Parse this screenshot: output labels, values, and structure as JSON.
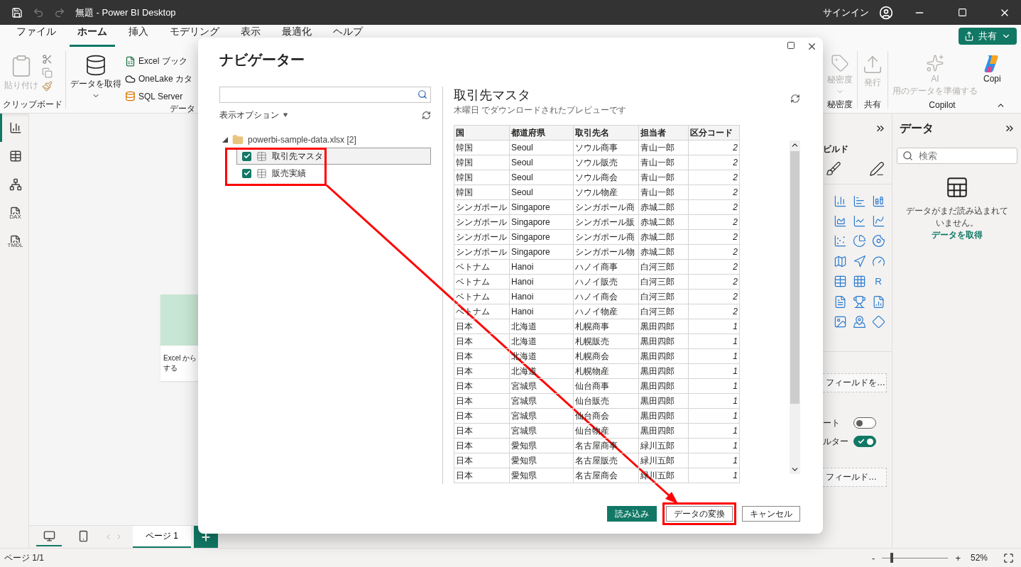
{
  "window": {
    "title": "無題 - Power BI Desktop",
    "sign_in": "サインイン",
    "undo_disabled": true
  },
  "menu_tabs": [
    {
      "label": "ファイル",
      "selected": false
    },
    {
      "label": "ホーム",
      "selected": true
    },
    {
      "label": "挿入",
      "selected": false
    },
    {
      "label": "モデリング",
      "selected": false
    },
    {
      "label": "表示",
      "selected": false
    },
    {
      "label": "最適化",
      "selected": false
    },
    {
      "label": "ヘルプ",
      "selected": false
    }
  ],
  "share_button": {
    "label": "共有"
  },
  "ribbon": {
    "clipboard": {
      "paste": {
        "label": "貼り付け",
        "disabled": true
      },
      "group_label": "クリップボード"
    },
    "data": {
      "get_data": "データを取得",
      "sources": [
        {
          "kind": "excel",
          "label": "Excel ブック"
        },
        {
          "kind": "onelake",
          "label": "OneLake カタ"
        },
        {
          "kind": "sql",
          "label": "SQL Server"
        }
      ],
      "group_label": "データ"
    },
    "sensitivity": {
      "button": {
        "label": "秘密度",
        "disabled": true
      },
      "group_label": "秘密度"
    },
    "share": {
      "button": {
        "label": "発行",
        "disabled": true
      },
      "group_label": "共有"
    },
    "copilot": {
      "ai_button": {
        "lines": [
          "AI",
          "用のデータを準備する"
        ],
        "disabled": true
      },
      "copilot_button": {
        "label": "Copi",
        "disabled": false
      },
      "group_label": "Copilot"
    }
  },
  "rail": [
    {
      "kind": "report",
      "selected": true
    },
    {
      "kind": "table",
      "selected": false
    },
    {
      "kind": "model",
      "selected": false
    },
    {
      "kind": "dax",
      "label": "DAX",
      "selected": false
    },
    {
      "kind": "tmdl",
      "label": "TMDL",
      "selected": false
    }
  ],
  "canvas_card": {
    "lines": [
      "Excel から",
      "する"
    ]
  },
  "page_bar": {
    "views": [
      {
        "kind": "desktop",
        "selected": true
      },
      {
        "kind": "mobile",
        "selected": false
      }
    ],
    "pages": [
      {
        "label": "ページ 1",
        "selected": true
      }
    ]
  },
  "visualizations": {
    "section_label": "ビルド",
    "r_visual": "R",
    "well_1": "フィールドを…",
    "toggles": [
      {
        "label": "ート",
        "on": false
      },
      {
        "label": "ルター",
        "on": true
      }
    ],
    "well_2": "フィールド…"
  },
  "data_pane": {
    "title": "データ",
    "search_placeholder": "検索",
    "message": "データがまだ読み込まれていません。",
    "link": "データを取得"
  },
  "status_bar": {
    "page": "ページ 1/1",
    "zoom_out": "-",
    "zoom_in": "+",
    "zoom": {
      "level": 0.14
    },
    "zoom_reading": "52%"
  },
  "dialog": {
    "title": "ナビゲーター",
    "display_options": "表示オプション",
    "arrow": true,
    "tree": {
      "label": "powerbi-sample-data.xlsx [2]",
      "expanded": true,
      "highlight_frame": true,
      "children": [
        {
          "label": "取引先マスタ",
          "checked": true,
          "selected": true
        },
        {
          "label": "販売実績",
          "checked": true,
          "selected": false
        }
      ]
    },
    "preview": {
      "title": "取引先マスタ",
      "subtitle": "木曜日 でダウンロードされたプレビューです",
      "columns": [
        "国",
        "都道府県",
        "取引先名",
        "担当者",
        "区分コード"
      ],
      "rows": [
        [
          "韓国",
          "Seoul",
          "ソウル商事",
          "青山一郎",
          "2"
        ],
        [
          "韓国",
          "Seoul",
          "ソウル販売",
          "青山一郎",
          "2"
        ],
        [
          "韓国",
          "Seoul",
          "ソウル商会",
          "青山一郎",
          "2"
        ],
        [
          "韓国",
          "Seoul",
          "ソウル物産",
          "青山一郎",
          "2"
        ],
        [
          "シンガポール",
          "Singapore",
          "シンガポール商",
          "赤城二郎",
          "2"
        ],
        [
          "シンガポール",
          "Singapore",
          "シンガポール販",
          "赤城二郎",
          "2"
        ],
        [
          "シンガポール",
          "Singapore",
          "シンガポール商",
          "赤城二郎",
          "2"
        ],
        [
          "シンガポール",
          "Singapore",
          "シンガポール物",
          "赤城二郎",
          "2"
        ],
        [
          "ベトナム",
          "Hanoi",
          "ハノイ商事",
          "白河三郎",
          "2"
        ],
        [
          "ベトナム",
          "Hanoi",
          "ハノイ販売",
          "白河三郎",
          "2"
        ],
        [
          "ベトナム",
          "Hanoi",
          "ハノイ商会",
          "白河三郎",
          "2"
        ],
        [
          "ベトナム",
          "Hanoi",
          "ハノイ物産",
          "白河三郎",
          "2"
        ],
        [
          "日本",
          "北海道",
          "札幌商事",
          "黒田四郎",
          "1"
        ],
        [
          "日本",
          "北海道",
          "札幌販売",
          "黒田四郎",
          "1"
        ],
        [
          "日本",
          "北海道",
          "札幌商会",
          "黒田四郎",
          "1"
        ],
        [
          "日本",
          "北海道",
          "札幌物産",
          "黒田四郎",
          "1"
        ],
        [
          "日本",
          "宮城県",
          "仙台商事",
          "黒田四郎",
          "1"
        ],
        [
          "日本",
          "宮城県",
          "仙台販売",
          "黒田四郎",
          "1"
        ],
        [
          "日本",
          "宮城県",
          "仙台商会",
          "黒田四郎",
          "1"
        ],
        [
          "日本",
          "宮城県",
          "仙台物産",
          "黒田四郎",
          "1"
        ],
        [
          "日本",
          "愛知県",
          "名古屋商事",
          "緑川五郎",
          "1"
        ],
        [
          "日本",
          "愛知県",
          "名古屋販売",
          "緑川五郎",
          "1"
        ],
        [
          "日本",
          "愛知県",
          "名古屋商会",
          "緑川五郎",
          "1"
        ]
      ]
    },
    "buttons": [
      {
        "kind": "primary",
        "label": "読み込み",
        "highlighted": false
      },
      {
        "kind": "secondary",
        "label": "データの変換",
        "highlighted": true
      },
      {
        "kind": "secondary",
        "label": "キャンセル",
        "highlighted": false
      }
    ]
  }
}
